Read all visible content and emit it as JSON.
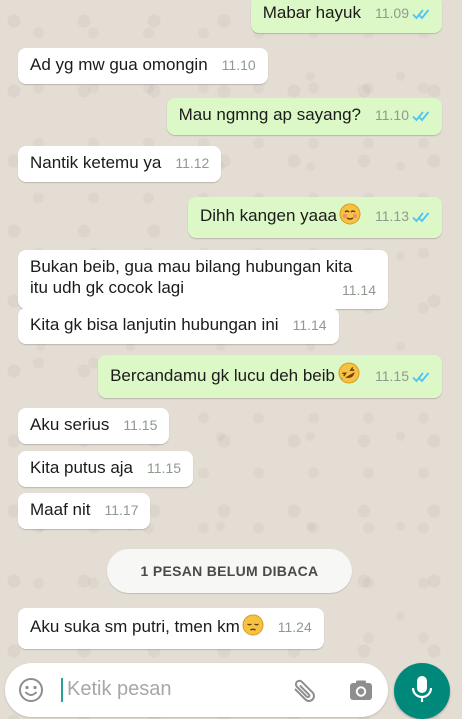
{
  "messages": [
    {
      "direction": "out",
      "text": "Mabar hayuk",
      "time": "11.09",
      "ticks": true
    },
    {
      "direction": "in",
      "text": "Ad yg mw gua omongin",
      "time": "11.10"
    },
    {
      "direction": "out",
      "text": "Mau ngmng ap sayang?",
      "time": "11.10",
      "ticks": true
    },
    {
      "direction": "in",
      "text": "Nantik ketemu ya",
      "time": "11.12"
    },
    {
      "direction": "out",
      "text": "Dihh kangen yaaa",
      "emoji": "blushing-face",
      "time": "11.13",
      "ticks": true
    },
    {
      "direction": "in",
      "line1": "Bukan beib, gua mau bilang hubungan kita",
      "line2": "itu udh gk cocok lagi",
      "time": "11.14"
    },
    {
      "direction": "in",
      "text": "Kita gk bisa lanjutin hubungan ini",
      "time": "11.14"
    },
    {
      "direction": "out",
      "text": "Bercandamu gk lucu deh beib",
      "emoji": "rolling-laughing-face",
      "time": "11.15",
      "ticks": true
    },
    {
      "direction": "in",
      "text": "Aku serius",
      "time": "11.15"
    },
    {
      "direction": "in",
      "text": "Kita putus aja",
      "time": "11.15"
    },
    {
      "direction": "in",
      "text": "Maaf nit",
      "time": "11.17"
    },
    {
      "direction": "in",
      "text": "Aku suka sm putri, tmen km",
      "emoji": "pensive-face",
      "time": "11.24"
    }
  ],
  "unread_banner": "1 PESAN BELUM DIBACA",
  "composer": {
    "placeholder": "Ketik pesan"
  },
  "colors": {
    "incoming": "#ffffff",
    "outgoing": "#dcf8c6",
    "read_ticks": "#4fc3f7",
    "accent": "#00897b"
  }
}
